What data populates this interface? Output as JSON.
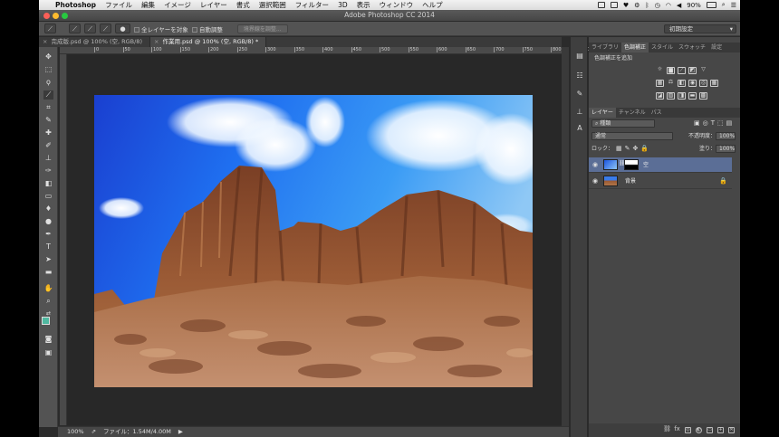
{
  "menubar": {
    "app": "Photoshop",
    "items": [
      "ファイル",
      "編集",
      "イメージ",
      "レイヤー",
      "書式",
      "選択範囲",
      "フィルター",
      "3D",
      "表示",
      "ウィンドウ",
      "ヘルプ"
    ],
    "battery": "90%"
  },
  "window": {
    "title": "Adobe Photoshop CC 2014"
  },
  "options": {
    "all_layers_label": "全レイヤーを対象",
    "auto_enhance_label": "自動調整",
    "refine_edge_label": "境界線を調整...",
    "workspace": "初期設定"
  },
  "tabs": [
    {
      "label": "完成版.psd @ 100% (空, RGB/8)"
    },
    {
      "label": "作業用.psd @ 100% (空, RGB/8) *"
    }
  ],
  "ruler": {
    "ticks": [
      "0",
      "50",
      "100",
      "150",
      "200",
      "250",
      "300",
      "350",
      "400",
      "450",
      "500",
      "550",
      "600",
      "650",
      "700",
      "750",
      "800",
      "850",
      "900"
    ]
  },
  "status": {
    "zoom": "100%",
    "file_info": "ファイル：1.54M/4.00M"
  },
  "adjust_panel": {
    "tabs": [
      "ライブラリ",
      "色調補正",
      "スタイル",
      "スウォッチ",
      "設定"
    ],
    "add_label": "色調補正を追加"
  },
  "layers_panel": {
    "tabs": [
      "レイヤー",
      "チャンネル",
      "パス"
    ],
    "filter_kind": "種類",
    "blend_mode": "通常",
    "opacity_label": "不透明度：",
    "opacity_value": "100%",
    "lock_label": "ロック：",
    "fill_label": "塗り：",
    "fill_value": "100%",
    "layers": [
      {
        "name": "空"
      },
      {
        "name": "背景"
      }
    ]
  },
  "colors": {
    "foreground": "#4fb8a0",
    "background": "#000000"
  }
}
